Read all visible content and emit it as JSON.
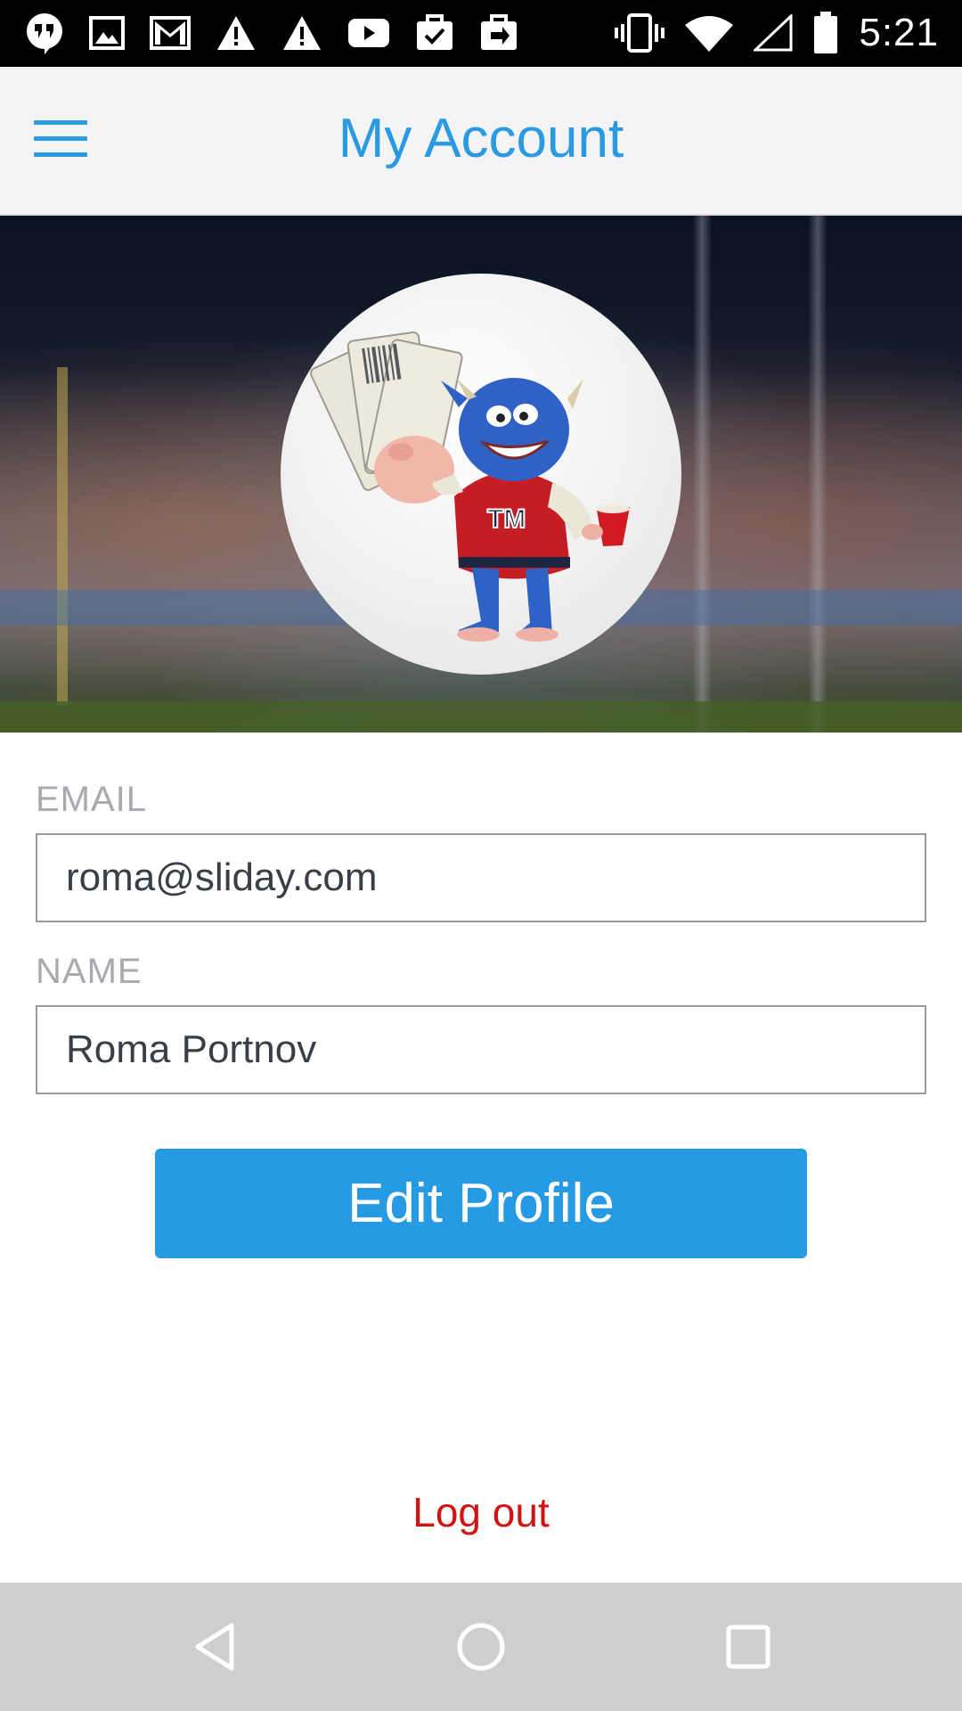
{
  "status_bar": {
    "time": "5:21",
    "left_icons": [
      "hangouts-icon",
      "image-icon",
      "gmail-icon",
      "warning-icon",
      "warning-icon",
      "youtube-icon",
      "task-icon",
      "work-icon"
    ],
    "right_icons": [
      "vibrate-icon",
      "wifi-icon",
      "signal-icon",
      "battery-icon"
    ]
  },
  "header": {
    "title": "My Account",
    "menu_icon": "hamburger-menu-icon",
    "accent_color": "#2a9ae3"
  },
  "profile": {
    "avatar": "monster-mascot-avatar"
  },
  "form": {
    "email_label": "EMAIL",
    "email_value": "roma@sliday.com",
    "name_label": "NAME",
    "name_value": "Roma Portnov",
    "edit_button": "Edit Profile",
    "button_color": "#279ae4"
  },
  "logout": {
    "label": "Log out",
    "color": "#d01414"
  },
  "nav_bar": {
    "buttons": [
      "back-icon",
      "home-icon",
      "recents-icon"
    ]
  }
}
